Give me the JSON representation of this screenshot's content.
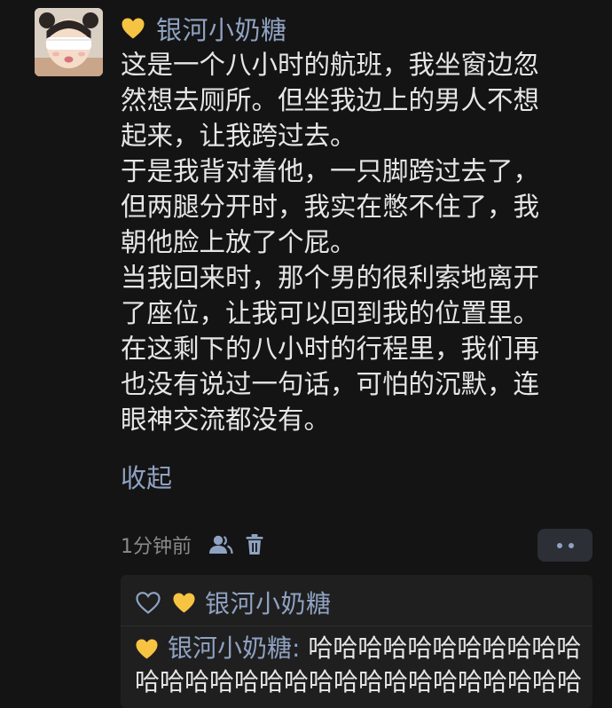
{
  "post": {
    "author": "银河小奶糖",
    "paragraphs": [
      "这是一个八小时的航班，我坐窗边忽\n然想去厕所。但坐我边上的男人不想\n起来，让我跨过去。",
      "于是我背对着他，一只脚跨过去了，\n但两腿分开时，我实在憋不住了，我\n朝他脸上放了个屁。",
      "当我回来时，那个男的很利索地离开\n了座位，让我可以回到我的位置里。",
      "在这剩下的八小时的行程里，我们再\n也没有说过一句话，可怕的沉默，连\n眼神交流都没有。"
    ],
    "collapse_label": "收起",
    "time": "1分钟前"
  },
  "comments": {
    "liker": "银河小奶糖",
    "items": [
      {
        "author": "银河小奶糖",
        "separator": ": ",
        "text": "哈哈哈哈哈哈哈哈哈哈哈哈哈哈哈哈哈哈哈哈哈哈哈哈哈哈哈哈哈"
      }
    ]
  },
  "icons": {
    "badge": "yellow-heart-icon",
    "visibility": "user-group-icon",
    "delete": "trash-icon",
    "more": "more-dots-icon",
    "like": "heart-outline-icon"
  },
  "colors": {
    "background": "#141414",
    "name": "#8fa2c2",
    "text": "#e6e6e6",
    "time": "#8a8a8a",
    "heart": "#f6c343",
    "comment_bg": "#1f1f1f"
  }
}
